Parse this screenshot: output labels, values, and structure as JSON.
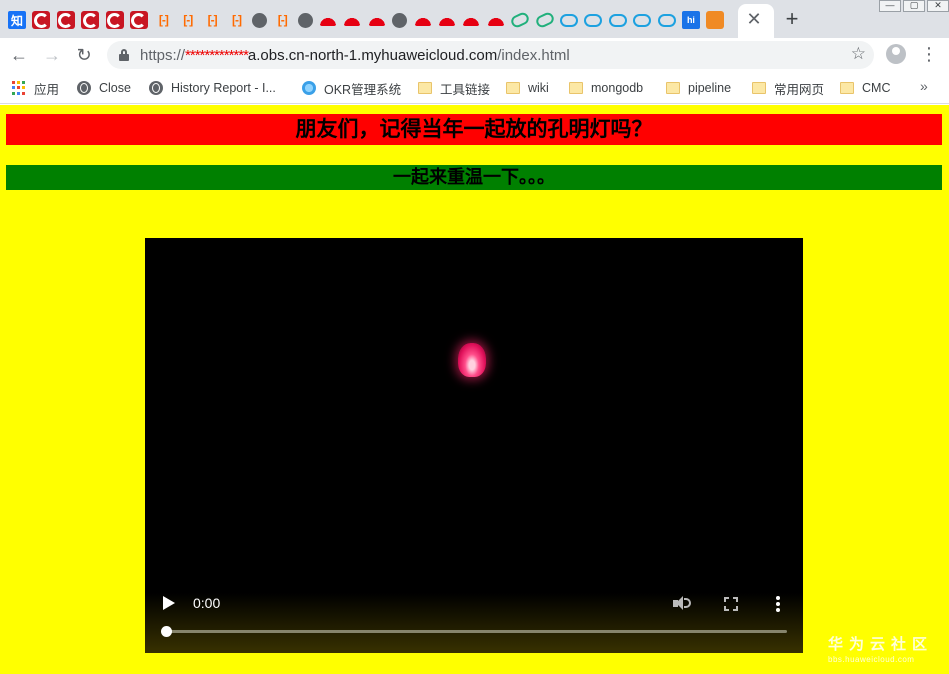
{
  "browser": {
    "tabs": {
      "favicons": [
        "zhihu-icon",
        "csdn-icon",
        "csdn-icon",
        "csdn-icon",
        "csdn-icon",
        "csdn-icon",
        "aliyun-icon",
        "aliyun-icon",
        "aliyun-icon",
        "aliyun-icon",
        "globe-icon",
        "aliyun-icon",
        "globe-icon",
        "huawei-icon",
        "huawei-icon",
        "huawei-icon",
        "globe-icon",
        "huawei-icon",
        "huawei-icon",
        "huawei-icon",
        "huawei-icon",
        "link-icon",
        "link-icon",
        "cloud-icon",
        "cloud-icon",
        "cloud-icon",
        "cloud-icon",
        "cloud-icon",
        "hi-icon",
        "cube-icon"
      ],
      "zhihu_glyph": "知",
      "bracket_glyph": "[-]",
      "hi_glyph": "hi",
      "close_glyph": "✕",
      "new_tab_glyph": "+"
    },
    "window_controls": [
      "—",
      "▢",
      "✕"
    ],
    "nav": {
      "back_glyph": "←",
      "forward_glyph": "→",
      "reload_glyph": "↻"
    },
    "address": {
      "scheme": "https://",
      "masked": "*************",
      "host": "a.obs.cn-north-1.myhuaweicloud.com",
      "path": "/index.html"
    },
    "star_glyph": "☆",
    "menu_glyph": "⋮",
    "bookmarks": {
      "apps": "应用",
      "items": [
        "Close",
        "History Report - I...",
        "OKR管理系统",
        "工具链接",
        "wiki",
        "mongodb",
        "pipeline",
        "常用网页",
        "CMC"
      ],
      "more_glyph": "»"
    },
    "colors": {
      "apps_dots": [
        "#ea4335",
        "#fbbc04",
        "#34a853",
        "#4285f4",
        "#ea4335",
        "#fbbc04",
        "#34a853",
        "#4285f4",
        "#ea4335"
      ]
    }
  },
  "page": {
    "heading1": "朋友们，记得当年一起放的孔明灯吗？",
    "heading2": "一起来重温一下。。。",
    "colors": {
      "background": "#ffff00",
      "heading1_bg": "#ff0000",
      "heading2_bg": "#008000"
    },
    "video": {
      "current_time": "0:00",
      "progress": 0
    },
    "watermark": {
      "main": "华为云社区",
      "sub": "bbs.huaweicloud.com"
    }
  }
}
